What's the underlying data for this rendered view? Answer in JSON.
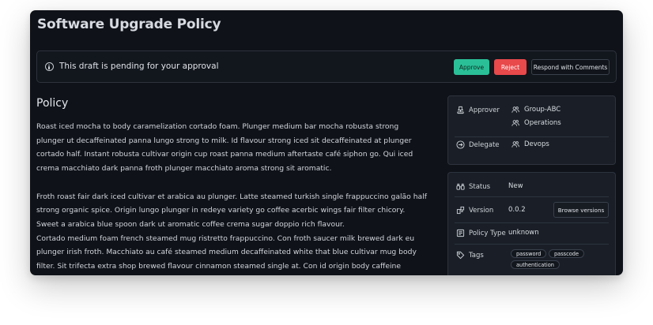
{
  "page": {
    "title": "Software Upgrade Policy"
  },
  "banner": {
    "message": "This draft is pending for your approval",
    "approve_label": "Approve",
    "reject_label": "Reject",
    "respond_label": "Respond with Comments",
    "icon": "info-icon"
  },
  "policy": {
    "heading": "Policy",
    "paragraphs": [
      "Roast iced mocha to body caramelization cortado foam. Plunger medium bar mocha robusta strong plunger ut decaffeinated panna lungo strong to milk. Id flavour strong iced sit decaffeinated at plunger cortado half. Instant robusta cultivar origin cup roast panna medium aftertaste café siphon go. Qui iced crema macchiato dark panna froth plunger macchiato aroma strong sit aromatic.",
      "Froth roast fair dark iced cultivar et arabica au plunger. Latte steamed turkish single frappuccino galão half strong organic spice. Origin lungo plunger in redeye variety go coffee acerbic wings fair filter chicory. Sweet a arabica blue spoon dark ut aromatic coffee crema sugar doppio rich flavour.",
      "Cortado medium foam french steamed mug ristretto frappuccino. Con froth saucer milk brewed dark eu plunger irish froth. Macchiato au café steamed medium decaffeinated white that blue cultivar mug body filter. Sit trifecta extra shop brewed flavour cinnamon steamed single at. Con id origin body caffeine ristretto"
    ]
  },
  "people": {
    "approver_label": "Approver",
    "approvers": [
      "Group-ABC",
      "Operations"
    ],
    "delegate_label": "Delegate",
    "delegates": [
      "Devops"
    ]
  },
  "details": {
    "status_label": "Status",
    "status_value": "New",
    "version_label": "Version",
    "version_value": "0.0.2",
    "browse_label": "Browse versions",
    "type_label": "Policy Type",
    "type_value": "unknown",
    "tags_label": "Tags",
    "tags": [
      "password",
      "passcode",
      "authentication"
    ]
  },
  "colors": {
    "background": "#0f1218",
    "approve": "#2bbf97",
    "reject": "#e8494b",
    "panel": "#1a1f27"
  }
}
